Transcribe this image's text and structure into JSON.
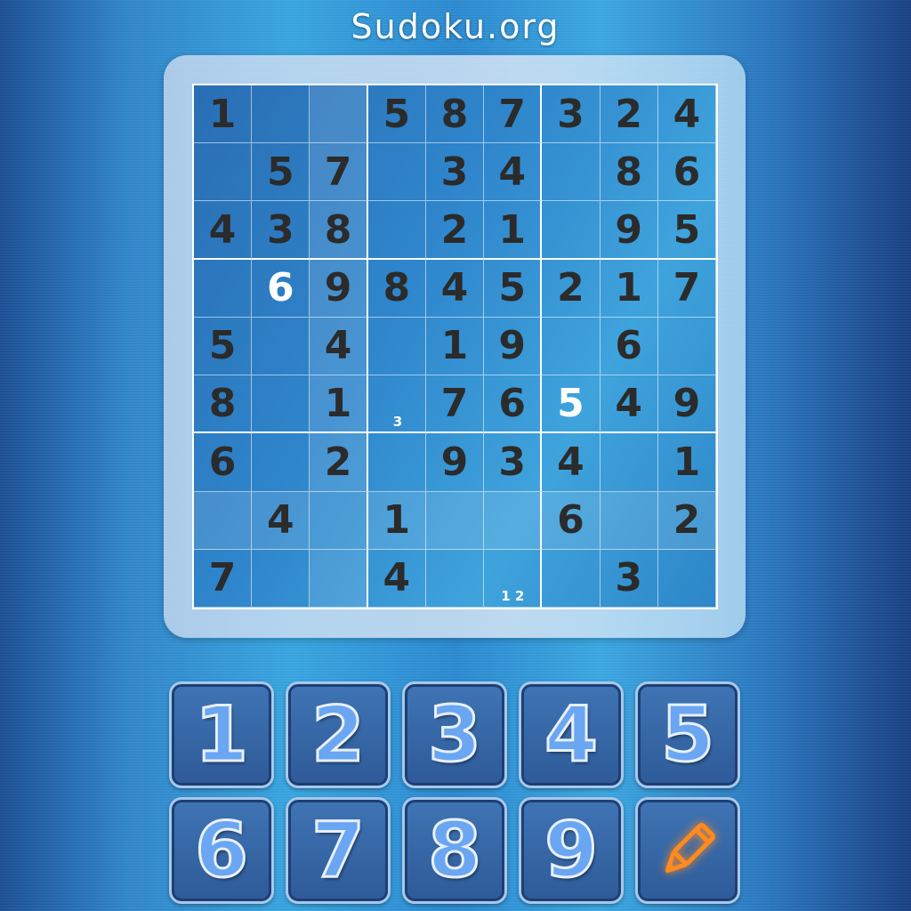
{
  "header": {
    "title": "Sudoku.org"
  },
  "board": {
    "rows": [
      [
        "1",
        "",
        "",
        "5",
        "8",
        "7",
        "3",
        "2",
        "4"
      ],
      [
        "",
        "5",
        "7",
        "",
        "3",
        "4",
        "",
        "8",
        "6"
      ],
      [
        "4",
        "3",
        "8",
        "",
        "2",
        "1",
        "",
        "9",
        "5"
      ],
      [
        "",
        "6",
        "9",
        "8",
        "4",
        "5",
        "2",
        "1",
        "7"
      ],
      [
        "5",
        "",
        "4",
        "",
        "1",
        "9",
        "",
        "6",
        ""
      ],
      [
        "8",
        "",
        "1",
        "",
        "7",
        "6",
        "5",
        "4",
        "9"
      ],
      [
        "6",
        "",
        "2",
        "",
        "9",
        "3",
        "4",
        "",
        "1"
      ],
      [
        "",
        "4",
        "",
        "1",
        "",
        "",
        "6",
        "",
        "2"
      ],
      [
        "7",
        "",
        "",
        "4",
        "",
        "",
        "",
        "3",
        ""
      ]
    ],
    "highlighted_cells": [
      "r1c3",
      "r2c3",
      "r3c3",
      "r4c3",
      "r5c3",
      "r6c3",
      "r7c3",
      "r8c1",
      "r8c2",
      "r8c3",
      "r8c4",
      "r8c5",
      "r8c6",
      "r8c7",
      "r8c8",
      "r8c9",
      "r9c3"
    ],
    "white_cells": [
      "r4c2",
      "r6c7"
    ],
    "notes": [
      {
        "cell": "r6c4",
        "text": "3"
      },
      {
        "cell": "r9c6",
        "text": "1 2"
      }
    ]
  },
  "keypad": {
    "keys": [
      "1",
      "2",
      "3",
      "4",
      "5",
      "6",
      "7",
      "8",
      "9"
    ],
    "pencil_icon": "pencil-icon",
    "pencil_color": "#ff8a1e"
  }
}
